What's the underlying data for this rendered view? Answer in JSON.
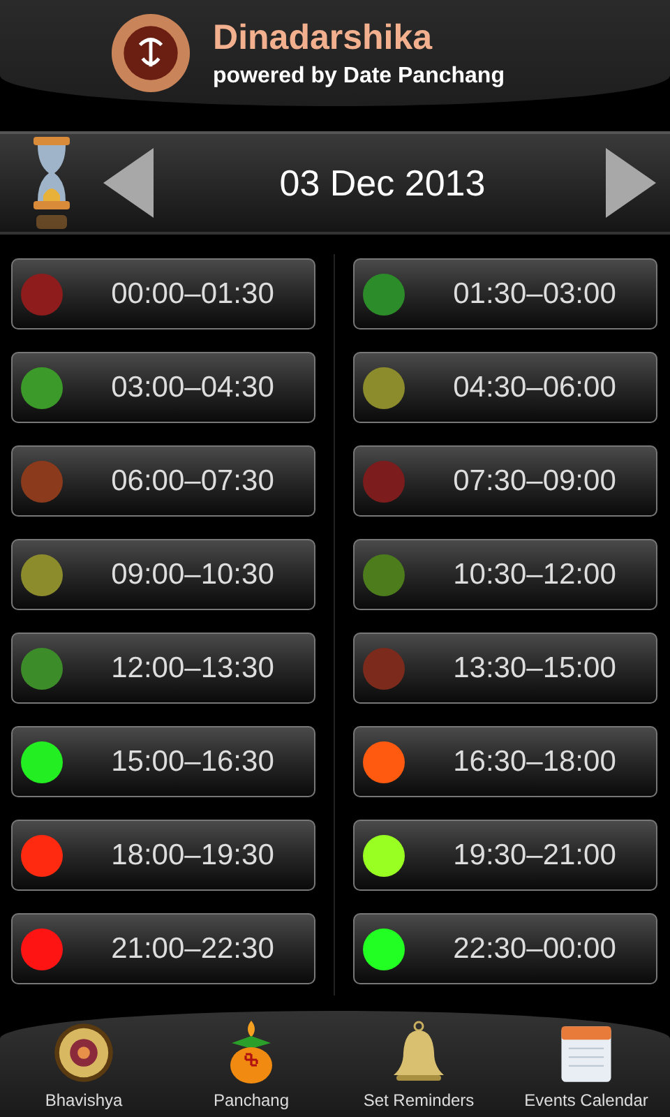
{
  "header": {
    "title": "Dinadarshika",
    "subtitle": "powered by Date Panchang"
  },
  "date_bar": {
    "date": "03 Dec 2013"
  },
  "slots": [
    {
      "time": "00:00–01:30",
      "color": "#8e1c1c"
    },
    {
      "time": "01:30–03:00",
      "color": "#2c8c2a"
    },
    {
      "time": "03:00–04:30",
      "color": "#3c9a2a"
    },
    {
      "time": "04:30–06:00",
      "color": "#8c8c2c"
    },
    {
      "time": "06:00–07:30",
      "color": "#8c3a1c"
    },
    {
      "time": "07:30–09:00",
      "color": "#7c1c1c"
    },
    {
      "time": "09:00–10:30",
      "color": "#8c8c2c"
    },
    {
      "time": "10:30–12:00",
      "color": "#4c7c1c"
    },
    {
      "time": "12:00–13:30",
      "color": "#3c8c2a"
    },
    {
      "time": "13:30–15:00",
      "color": "#7c2a1c"
    },
    {
      "time": "15:00–16:30",
      "color": "#22ee22"
    },
    {
      "time": "16:30–18:00",
      "color": "#ff5a10"
    },
    {
      "time": "18:00–19:30",
      "color": "#ff2a10"
    },
    {
      "time": "19:30–21:00",
      "color": "#99ff22"
    },
    {
      "time": "21:00–22:30",
      "color": "#ff1414"
    },
    {
      "time": "22:30–00:00",
      "color": "#22ff22"
    }
  ],
  "tabs": [
    {
      "label": "Bhavishya",
      "kind": "wheel"
    },
    {
      "label": "Panchang",
      "kind": "pot"
    },
    {
      "label": "Set Reminders",
      "kind": "bell"
    },
    {
      "label": "Events Calendar",
      "kind": "calendar"
    }
  ]
}
